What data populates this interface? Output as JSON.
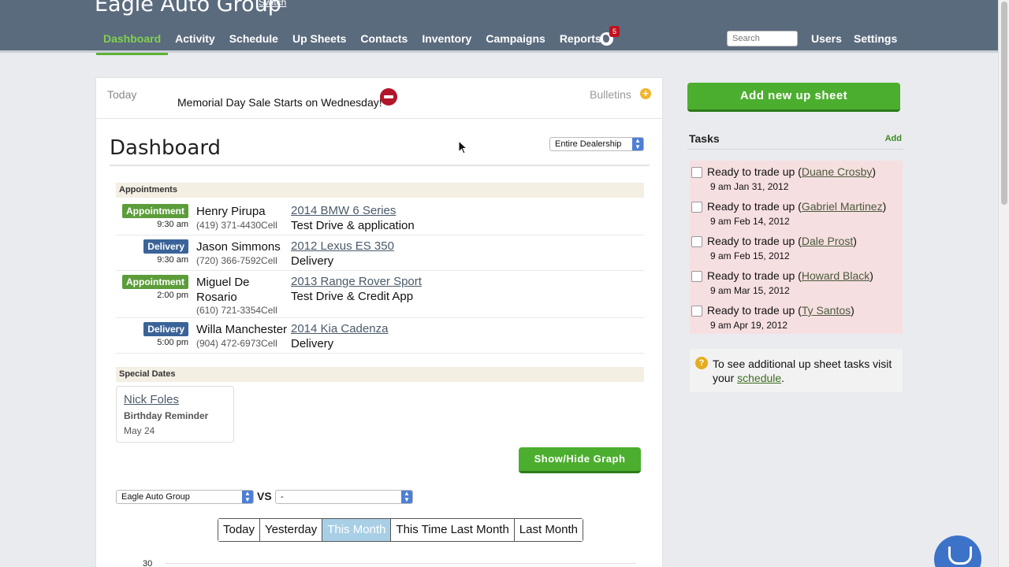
{
  "header": {
    "brand": "Eagle Auto Group",
    "switch_label": "Switch",
    "nav": [
      "Dashboard",
      "Activity",
      "Schedule",
      "Up Sheets",
      "Contacts",
      "Inventory",
      "Campaigns",
      "Reports"
    ],
    "notification_count": "5",
    "search_placeholder": "Search",
    "users_label": "Users",
    "settings_label": "Settings"
  },
  "bulletin": {
    "today_label": "Today",
    "text": "Memorial Day Sale Starts on Wednesday!",
    "bulletins_label": "Bulletins",
    "add_icon": "+"
  },
  "dashboard": {
    "title": "Dashboard",
    "scope_select": "Entire Dealership",
    "appointments_heading": "Appointments",
    "appointments": [
      {
        "type": "Appointment",
        "time": "9:30 am",
        "name": "Henry Pirupa",
        "phone": "(419) 371-4430Cell",
        "vehicle": "2014 BMW 6 Series",
        "purpose": "Test Drive & application"
      },
      {
        "type": "Delivery",
        "time": "9:30 am",
        "name": "Jason Simmons",
        "phone": "(720) 366-7592Cell",
        "vehicle": "2012 Lexus ES 350",
        "purpose": "Delivery"
      },
      {
        "type": "Appointment",
        "time": "2:00 pm",
        "name_line1": "Miguel De",
        "name_line2": "Rosario",
        "phone": "(610) 721-3354Cell",
        "vehicle": "2013 Range Rover Sport",
        "purpose": "Test Drive & Credit App"
      },
      {
        "type": "Delivery",
        "time": "5:00 pm",
        "name": "Willa Manchester",
        "phone": "(904) 472-6973Cell",
        "vehicle": "2014 Kia Cadenza",
        "purpose": "Delivery"
      }
    ],
    "special_dates_heading": "Special Dates",
    "special_date": {
      "name": "Nick Foles",
      "type": "Birthday Reminder",
      "date": "May 24"
    },
    "show_hide_graph": "Show/Hide Graph",
    "compare_left": "Eagle Auto Group",
    "vs_label": "VS",
    "compare_right": "-",
    "ranges": [
      "Today",
      "Yesterday",
      "This Month",
      "This Time Last Month",
      "Last Month"
    ],
    "active_range": "This Month",
    "y_tick_top": "30"
  },
  "sidebar": {
    "add_up_sheet": "Add new up sheet",
    "tasks_title": "Tasks",
    "tasks_add": "Add",
    "tasks": [
      {
        "prefix": "Ready to trade up (",
        "person": "Duane Crosby",
        "suffix": ")",
        "date": "9 am Jan 31, 2012"
      },
      {
        "prefix": "Ready to trade up (",
        "person": "Gabriel Martinez",
        "suffix": ")",
        "date": "9 am Feb 14, 2012"
      },
      {
        "prefix": "Ready to trade up (",
        "person": "Dale Prost",
        "suffix": ")",
        "date": "9 am Feb 15, 2012"
      },
      {
        "prefix": "Ready to trade up (",
        "person": "Howard Black",
        "suffix": ")",
        "date": "9 am Mar 15, 2012"
      },
      {
        "prefix": "Ready to trade up (",
        "person": "Ty Santos",
        "suffix": ")",
        "date": "9 am Apr 19, 2012"
      }
    ],
    "info_q": "?",
    "info_prefix": "To see additional up sheet tasks visit your ",
    "info_link": "schedule",
    "info_suffix": "."
  },
  "colors": {
    "header_bg": "#5b6b7e",
    "nav_active": "#7fd14e",
    "green_button": "#4cae2f",
    "appointment_tag": "#5c9d3a",
    "delivery_tag": "#3a6398",
    "task_bg": "#f6dfe1"
  }
}
